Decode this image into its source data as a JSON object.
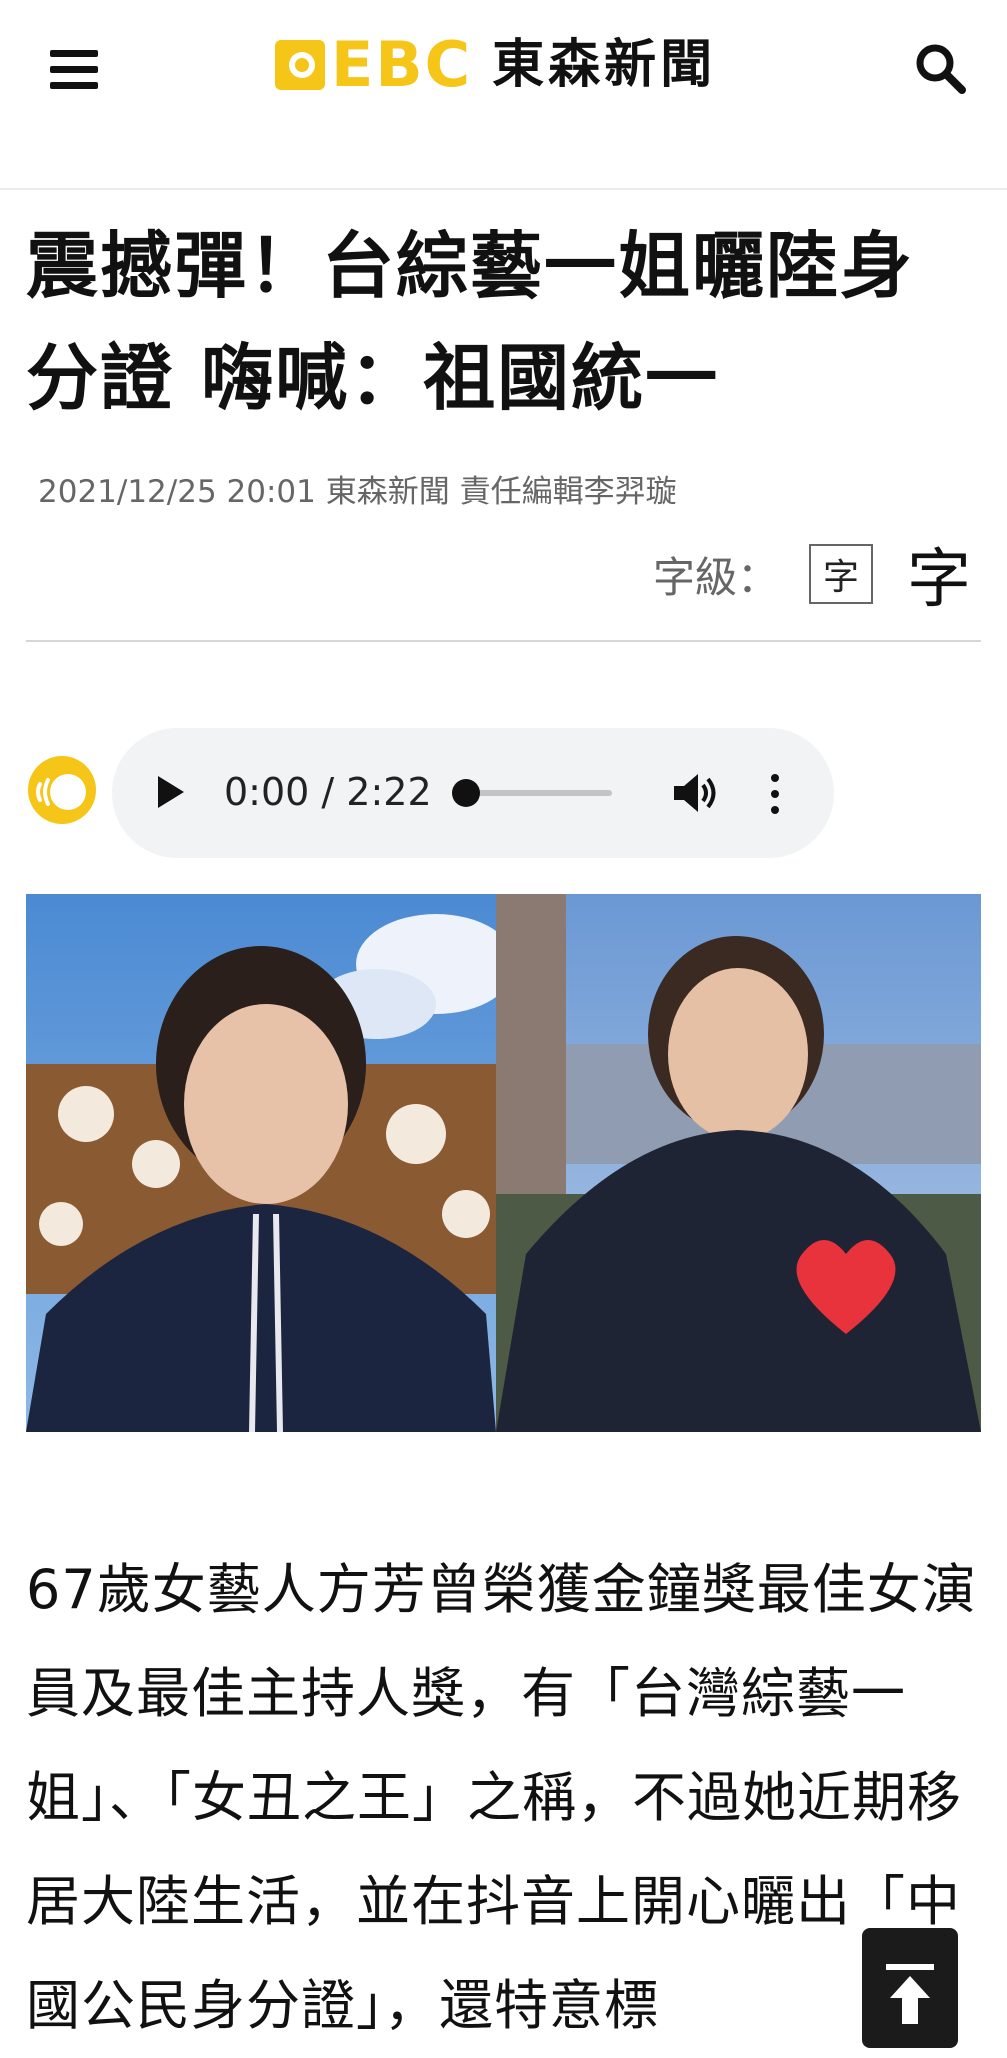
{
  "header": {
    "logo_letters": "EBC",
    "logo_text": "東森新聞",
    "brand_color": "#f5c518"
  },
  "icons": {
    "menu": "menu-icon",
    "search": "search-icon",
    "tts": "tts-icon",
    "volume": "volume-icon",
    "more": "more-icon",
    "back_to_top": "back-to-top-icon"
  },
  "article": {
    "title": "震撼彈！台綜藝一姐曬陸身分證 嗨喊：祖國統一",
    "meta": "2021/12/25 20:01 東森新聞 責任編輯李羿璇",
    "font_size_label": "字級：",
    "font_small": "字",
    "font_large": "字",
    "body": "67歲女藝人方芳曾榮獲金鐘獎最佳女演員及最佳主持人獎，有「台灣綜藝一姐」、「女丑之王」之稱，不過她近期移居大陸生活，並在抖音上開心曬出「中國公民身分證」，還特意標"
  },
  "audio": {
    "time": "0:00 / 2:22",
    "progress": 0.0
  }
}
